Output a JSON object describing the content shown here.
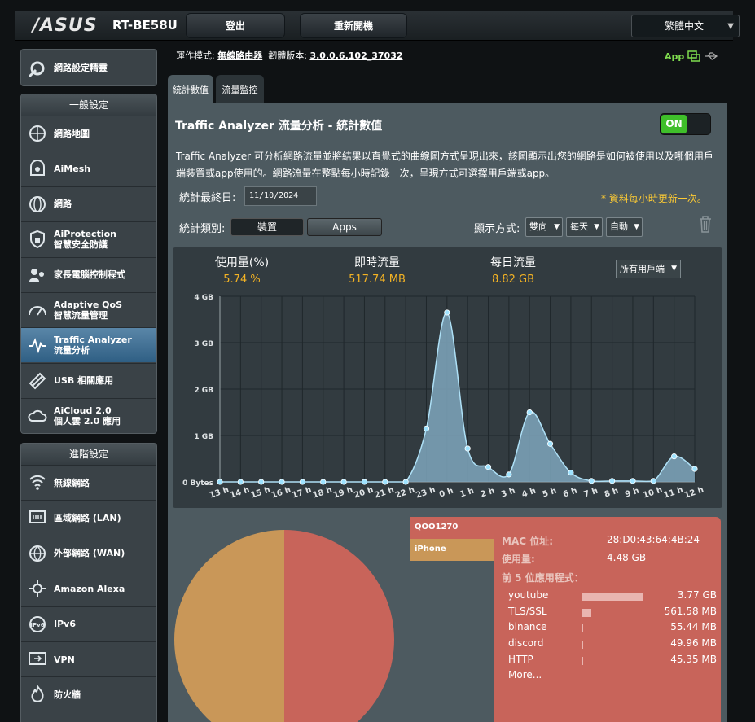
{
  "header": {
    "brand": "/ASUS",
    "model": "RT-BE58U",
    "logout": "登出",
    "reboot": "重新開機",
    "language": "繁體中文"
  },
  "sidebar": {
    "quick": "網路設定精靈",
    "general_title": "一般設定",
    "general": [
      {
        "l1": "網路地圖",
        "l2": ""
      },
      {
        "l1": "AiMesh",
        "l2": ""
      },
      {
        "l1": "網路",
        "l2": ""
      },
      {
        "l1": "AiProtection",
        "l2": "智慧安全防護"
      },
      {
        "l1": "家長電腦控制程式",
        "l2": ""
      },
      {
        "l1": "Adaptive QoS",
        "l2": "智慧流量管理"
      },
      {
        "l1": "Traffic Analyzer",
        "l2": "流量分析"
      },
      {
        "l1": "USB 相關應用",
        "l2": ""
      },
      {
        "l1": "AiCloud 2.0",
        "l2": "個人雲 2.0 應用"
      }
    ],
    "advanced_title": "進階設定",
    "advanced": [
      {
        "l1": "無線網路"
      },
      {
        "l1": "區域網路 (LAN)"
      },
      {
        "l1": "外部網路 (WAN)"
      },
      {
        "l1": "Amazon Alexa"
      },
      {
        "l1": "IPv6"
      },
      {
        "l1": "VPN"
      },
      {
        "l1": "防火牆"
      }
    ]
  },
  "topbar": {
    "mode_label": "運作模式:",
    "mode_value": "無線路由器",
    "fw_label": "韌體版本:",
    "fw_value": "3.0.0.6.102_37032",
    "app": "App"
  },
  "tabs": [
    "統計數值",
    "流量監控"
  ],
  "page": {
    "title": "Traffic Analyzer 流量分析 - 統計數值",
    "toggle": "ON",
    "description": "Traffic Analyzer 可分析網路流量並將結果以直覺式的曲線圖方式呈現出來，該圖顯示出您的網路是如何被使用以及哪個用戶端裝置或app使用的。網路流量在整點每小時記錄一次，呈現方式可選擇用戶端或app。",
    "last_date_label": "統計最終日:",
    "last_date": "11/10/2024",
    "note": "* 資料每小時更新一次。",
    "category_label": "統計類別:",
    "cat_device": "裝置",
    "cat_apps": "Apps",
    "display_label": "顯示方式:",
    "sel1": "雙向",
    "sel2": "每天",
    "sel3": "自動"
  },
  "stats": {
    "usage_label": "使用量(%)",
    "usage_value": "5.74 %",
    "realtime_label": "即時流量",
    "realtime_value": "517.74 MB",
    "daily_label": "每日流量",
    "daily_value": "8.82 GB",
    "client_select": "所有用戶端"
  },
  "chart_data": {
    "type": "area",
    "x": [
      "13 h",
      "14 h",
      "15 h",
      "16 h",
      "17 h",
      "18 h",
      "19 h",
      "20 h",
      "21 h",
      "22 h",
      "23 h",
      "0 h",
      "1 h",
      "2 h",
      "3 h",
      "4 h",
      "5 h",
      "6 h",
      "7 h",
      "8 h",
      "9 h",
      "10 h",
      "11 h",
      "12 h"
    ],
    "values": [
      0,
      0,
      0,
      0,
      0,
      0,
      0,
      0,
      0,
      0,
      1.15,
      3.65,
      0.72,
      0.32,
      0.16,
      1.5,
      0.82,
      0.2,
      0.02,
      0.02,
      0.02,
      0.02,
      0.55,
      0.28
    ],
    "yticks": [
      "0 Bytes",
      "1 GB",
      "2 GB",
      "3 GB",
      "4 GB"
    ],
    "ylim": [
      0,
      4
    ],
    "grid": true
  },
  "devices": [
    {
      "name": "QOO1270",
      "color": "#c8645a"
    },
    {
      "name": "iPhone",
      "color": "#c99758"
    }
  ],
  "pie": {
    "values": [
      50,
      50
    ],
    "colors": [
      "#c8645a",
      "#c99758"
    ]
  },
  "detail": {
    "mac_label": "MAC 位址:",
    "mac": "28:D0:43:64:4B:24",
    "usage_label": "使用量:",
    "usage": "4.48 GB",
    "top_label": "前 5 位應用程式：",
    "apps": [
      {
        "name": "youtube",
        "size": "3.77 GB",
        "fraction": 0.87
      },
      {
        "name": "TLS/SSL",
        "size": "561.58 MB",
        "fraction": 0.13
      },
      {
        "name": "binance",
        "size": "55.44 MB",
        "fraction": 0.013
      },
      {
        "name": "discord",
        "size": "49.96 MB",
        "fraction": 0.011
      },
      {
        "name": "HTTP",
        "size": "45.35 MB",
        "fraction": 0.01
      }
    ],
    "more": "More..."
  }
}
